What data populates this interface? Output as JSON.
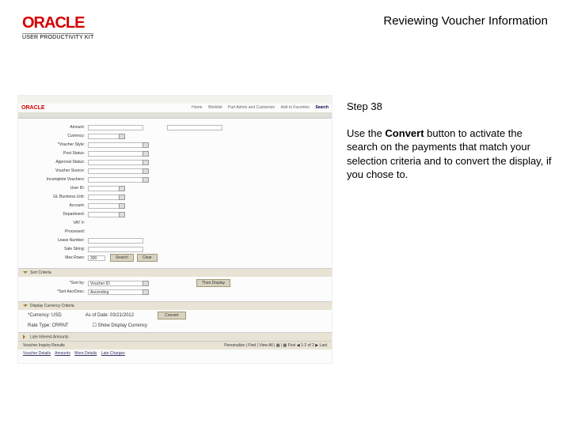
{
  "header": {
    "brand": "ORACLE",
    "subbrand": "USER PRODUCTIVITY KIT",
    "title": "Reviewing Voucher Information"
  },
  "step": {
    "label": "Step 38",
    "text_before": "Use the ",
    "bold": "Convert",
    "text_after": " button to activate the search on the payments that match your selection criteria and to convert the display, if you chose to."
  },
  "ss": {
    "topbrand": "ORACLE",
    "tabs": {
      "t1": "Home",
      "t2": "Worklist",
      "t3": "Part Admin and Customize",
      "t4": "Add to Favorites",
      "search": "Search"
    },
    "form": {
      "amount": "Amount:",
      "currency": "Currency:",
      "voucher_style": "*Voucher Style:",
      "post_status": "Post Status:",
      "approval_status": "Approval Status:",
      "voucher_source": "Voucher Source:",
      "incomplete": "Incomplete Vouchers:",
      "user_id": "User ID:",
      "gl_biz_unit": "GL Business Unit:",
      "account": "Account:",
      "department": "Department:",
      "vat": "VAT #:",
      "processed": "Processed:",
      "lease_number": "Lease Number:",
      "sale_string": "Sale String:",
      "max_rows": "Max Rows:",
      "max_rows_val": "300",
      "btn_search": "Search",
      "btn_clear": "Clear"
    },
    "sort": {
      "title": "Sort Criteria",
      "sort_by": "*Sort by:",
      "sort_by_val": "Voucher ID",
      "sort_asc": "*Sort Asc/Desc:",
      "sort_asc_val": "Ascending",
      "then_display": "Then Display"
    },
    "display": {
      "title": "Display Currency Criteria",
      "currency": "*Currency:",
      "currency_val": "USD",
      "as_of_date": "As of Date:",
      "as_of_date_val": "03/21/2012",
      "rate_type": "Rate Type:",
      "rate_type_val": "CRRNT",
      "show_disp": "Show Display Currency",
      "convert": "Convert"
    },
    "late": {
      "title": "Late Interest Amounts"
    },
    "results": {
      "title": "Voucher Inquiry Results",
      "nav": "Personalize | Find | View All | ▦ | ▦    First ◀ 1-2 of 2 ▶ Last"
    },
    "footer": {
      "a": "Voucher Details",
      "b": "Amounts",
      "c": "More Details",
      "d": "Late Charges"
    }
  }
}
